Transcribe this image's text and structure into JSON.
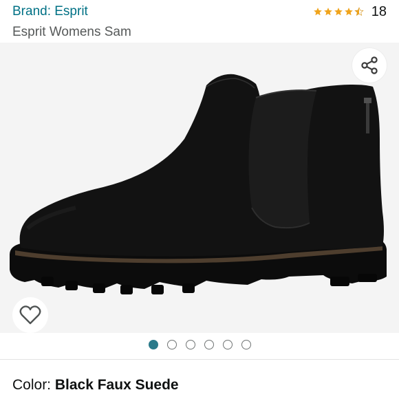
{
  "header": {
    "brand_link": "Brand: Esprit",
    "product_title": "Esprit Womens Sam",
    "rating_stars": 4.5,
    "rating_count": "18"
  },
  "gallery": {
    "image_count": 6,
    "active_index": 0
  },
  "variation": {
    "color_label": "Color: ",
    "color_value": "Black Faux Suede"
  },
  "colors": {
    "brand_link": "#007185",
    "star": "#f0a41c",
    "active_dot": "#2a7a8a"
  },
  "icons": {
    "share": "share-icon",
    "wishlist": "heart-outline-icon"
  }
}
